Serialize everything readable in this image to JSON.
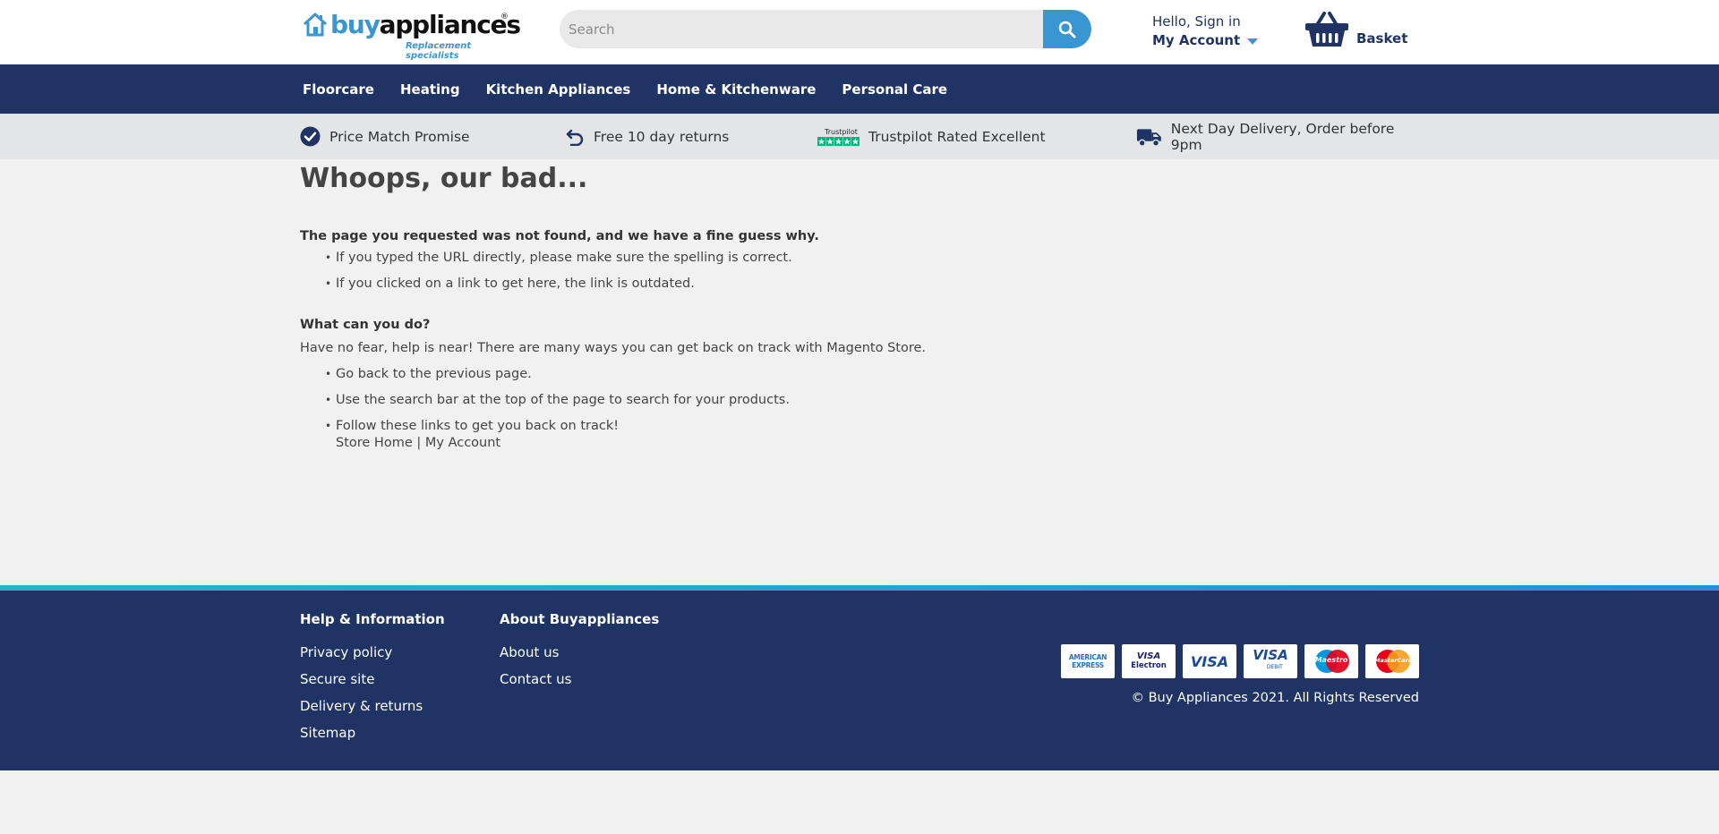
{
  "header": {
    "logo": {
      "brand_part1": "buy",
      "brand_part2": "appliances",
      "registered": "®",
      "tagline": "Replacement specialists"
    },
    "search": {
      "placeholder": "Search",
      "button_icon": "search-icon"
    },
    "account": {
      "greeting": "Hello, Sign in",
      "label": "My Account"
    },
    "basket": {
      "label": "Basket",
      "icon": "basket-icon"
    }
  },
  "nav": {
    "items": [
      "Floorcare",
      "Heating",
      "Kitchen Appliances",
      "Home & Kitchenware",
      "Personal Care"
    ]
  },
  "usp": [
    {
      "icon": "check-circle-icon",
      "label": "Price Match Promise"
    },
    {
      "icon": "return-arrow-icon",
      "label": "Free 10 day returns"
    },
    {
      "icon": "trustpilot-stars-icon",
      "badge": "Trustpilot",
      "label": "Trustpilot Rated Excellent"
    },
    {
      "icon": "delivery-truck-icon",
      "label": "Next Day Delivery, Order before 9pm"
    }
  ],
  "main": {
    "title": "Whoops, our bad...",
    "not_found_heading": "The page you requested was not found, and we have a fine guess why.",
    "reasons": [
      "If you typed the URL directly, please make sure the spelling is correct.",
      "If you clicked on a link to get here, the link is outdated."
    ],
    "what_heading": "What can you do?",
    "what_text": "Have no fear, help is near! There are many ways you can get back on track with Magento Store.",
    "actions": [
      "Go back to the previous page.",
      "Use the search bar at the top of the page to search for your products.",
      "Follow these links to get you back on track!"
    ],
    "links": {
      "store_home": "Store Home",
      "separator": "|",
      "my_account": "My Account"
    }
  },
  "footer": {
    "help": {
      "heading": "Help & Information",
      "links": [
        "Privacy policy",
        "Secure site",
        "Delivery & returns",
        "Sitemap"
      ]
    },
    "about": {
      "heading": "About Buyappliances",
      "links": [
        "About us",
        "Contact us"
      ]
    },
    "cards": [
      {
        "icon": "amex-icon",
        "text1": "AMERICAN",
        "text2": "EXPRESS"
      },
      {
        "icon": "visa-electron-icon",
        "text1": "VISA",
        "text2": "Electron"
      },
      {
        "icon": "visa-icon",
        "text1": "VISA"
      },
      {
        "icon": "visa-debit-icon",
        "text1": "VISA",
        "text2": "DEBIT"
      },
      {
        "icon": "maestro-icon",
        "text1": "Maestro"
      },
      {
        "icon": "mastercard-icon",
        "text1": "MasterCard"
      }
    ],
    "copyright": "© Buy Appliances 2021. All Rights Reserved"
  },
  "colors": {
    "navy": "#1f3464",
    "accent_blue": "#3a96d1",
    "page_bg": "#f1f1f1",
    "usp_bg": "#e3e5e6",
    "trustpilot_green": "#00b67a"
  }
}
